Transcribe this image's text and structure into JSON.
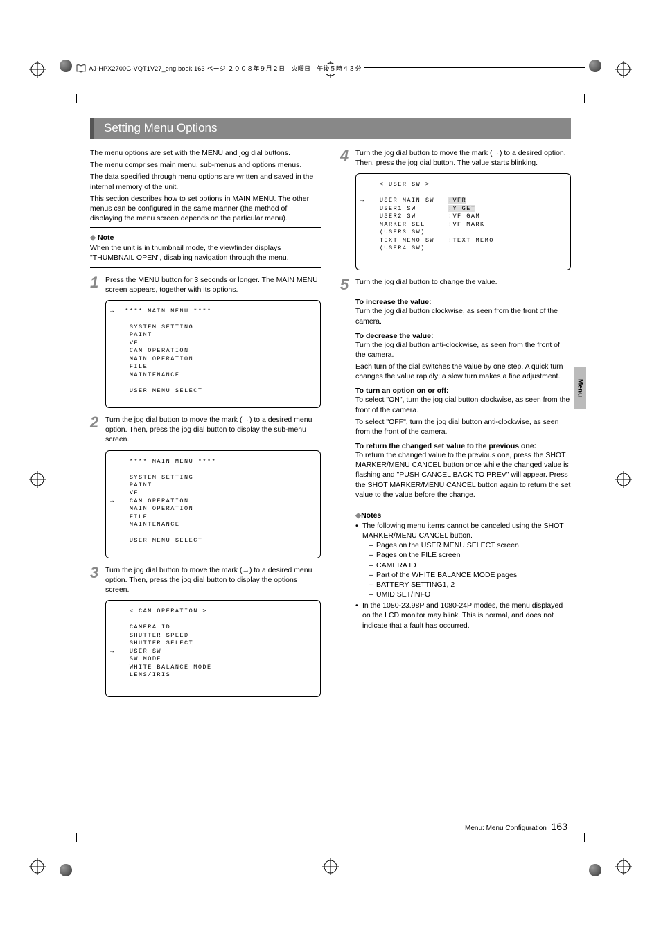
{
  "header": {
    "text": "AJ-HPX2700G-VQT1V27_eng.book  163 ページ  ２００８年９月２日　火曜日　午後５時４３分"
  },
  "title": "Setting Menu Options",
  "intro": {
    "p1": "The menu options are set with the MENU and jog dial buttons.",
    "p2": "The menu comprises main menu, sub-menus and options menus.",
    "p3": "The data specified through menu options are written and saved in the internal memory of the unit.",
    "p4": "This section describes how to set options in MAIN MENU. The other menus can be configured in the same manner (the method of displaying the menu screen depends on the particular menu)."
  },
  "note": {
    "head": "Note",
    "body": "When the unit is in thumbnail mode, the viewfinder displays \"THUMBNAIL OPEN\", disabling navigation through the menu."
  },
  "steps": {
    "s1": {
      "num": "1",
      "text": "Press the MENU button for 3 seconds or longer. The MAIN MENU screen appears, together with its options."
    },
    "s2": {
      "num": "2",
      "text": "Turn the jog dial button to move the mark (→) to a desired menu option. Then, press the jog dial button to display the sub-menu screen."
    },
    "s3": {
      "num": "3",
      "text": "Turn the jog dial button to move the mark (→) to a desired menu option. Then, press the jog dial button to display the options screen."
    },
    "s4": {
      "num": "4",
      "text": "Turn the jog dial button to move the mark (→) to a desired option. Then, press the jog dial button. The value starts blinking."
    },
    "s5": {
      "num": "5",
      "text": "Turn the jog dial button to change the value."
    }
  },
  "screens": {
    "main_menu_title": "**** MAIN MENU ****",
    "items": {
      "system_setting": "SYSTEM SETTING",
      "paint": "PAINT",
      "vf": "VF",
      "cam_operation": "CAM OPERATION",
      "main_operation": "MAIN OPERATION",
      "file": "FILE",
      "maintenance": "MAINTENANCE",
      "user_menu_select": "USER MENU SELECT"
    },
    "cam_op_title": "< CAM OPERATION >",
    "cam_op": {
      "camera_id": "CAMERA ID",
      "shutter_speed": "SHUTTER SPEED",
      "shutter_select": "SHUTTER SELECT",
      "user_sw": "USER SW",
      "sw_mode": "SW MODE",
      "white_balance_mode": "WHITE BALANCE MODE",
      "lens_iris": "LENS/IRIS"
    },
    "user_sw_title": "< USER SW >",
    "user_sw": {
      "user_main_sw": "USER MAIN SW",
      "user_main_sw_val": ":VFR",
      "user1_sw": "USER1 SW",
      "user1_sw_val": ":Y GET",
      "user2_sw": "USER2 SW",
      "user2_sw_val": ":VF GAM",
      "marker_sel": "MARKER SEL",
      "marker_sel_val": ":VF MARK",
      "user3_sw": "(USER3 SW)",
      "text_memo_sw": "TEXT MEMO SW",
      "text_memo_sw_val": ":TEXT MEMO",
      "user4_sw": "(USER4 SW)"
    }
  },
  "details": {
    "increase_head": "To increase the value:",
    "increase_body": "Turn the jog dial button clockwise, as seen from the front of the camera.",
    "decrease_head": "To decrease the value:",
    "decrease_body": "Turn the jog dial button anti-clockwise, as seen from the front of the camera.",
    "decrease_body2": "Each turn of the dial switches the value by one step. A quick turn changes the value rapidly; a slow turn makes a fine adjustment.",
    "onoff_head": "To turn an option on or off:",
    "onoff_body1": "To select \"ON\", turn the jog dial button clockwise, as seen from the front of the camera.",
    "onoff_body2": "To select \"OFF\", turn the jog dial button anti-clockwise, as seen from the front of the camera.",
    "return_head": "To return the changed set value to the previous one:",
    "return_body": "To return the changed value to the previous one, press the SHOT MARKER/MENU CANCEL button once while the changed value is flashing and \"PUSH CANCEL BACK TO PREV\" will appear. Press the SHOT MARKER/MENU CANCEL button again to return the set value to the value before the change."
  },
  "notes2": {
    "head": "Notes",
    "b1": "The following menu items cannot be canceled using the SHOT MARKER/MENU CANCEL button.",
    "d1": "Pages on the USER MENU SELECT screen",
    "d2": "Pages on the FILE screen",
    "d3": "CAMERA ID",
    "d4": "Part of the WHITE BALANCE MODE pages",
    "d5": "BATTERY SETTING1, 2",
    "d6": "UMID SET/INFO",
    "b2": "In the 1080-23.98P and 1080-24P modes, the menu displayed on the LCD monitor may blink. This is normal, and does not indicate that a fault has occurred."
  },
  "sidetab": "Menu",
  "footer": {
    "section": "Menu: Menu Configuration",
    "page": "163"
  }
}
